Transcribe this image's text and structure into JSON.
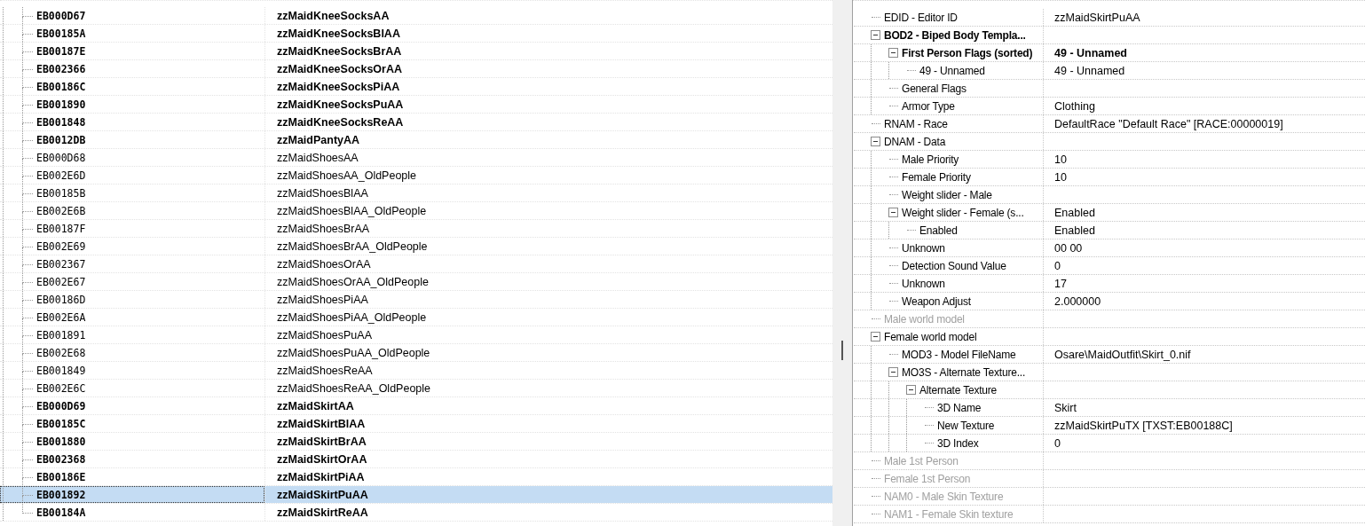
{
  "records": [
    {
      "form_id": "EB000D67",
      "editor_id": "zzMaidKneeSocksAA",
      "bold": true,
      "selected": false
    },
    {
      "form_id": "EB00185A",
      "editor_id": "zzMaidKneeSocksBlAA",
      "bold": true,
      "selected": false
    },
    {
      "form_id": "EB00187E",
      "editor_id": "zzMaidKneeSocksBrAA",
      "bold": true,
      "selected": false
    },
    {
      "form_id": "EB002366",
      "editor_id": "zzMaidKneeSocksOrAA",
      "bold": true,
      "selected": false
    },
    {
      "form_id": "EB00186C",
      "editor_id": "zzMaidKneeSocksPiAA",
      "bold": true,
      "selected": false
    },
    {
      "form_id": "EB001890",
      "editor_id": "zzMaidKneeSocksPuAA",
      "bold": true,
      "selected": false
    },
    {
      "form_id": "EB001848",
      "editor_id": "zzMaidKneeSocksReAA",
      "bold": true,
      "selected": false
    },
    {
      "form_id": "EB0012DB",
      "editor_id": "zzMaidPantyAA",
      "bold": true,
      "selected": false
    },
    {
      "form_id": "EB000D68",
      "editor_id": "zzMaidShoesAA",
      "bold": false,
      "selected": false
    },
    {
      "form_id": "EB002E6D",
      "editor_id": "zzMaidShoesAA_OldPeople",
      "bold": false,
      "selected": false
    },
    {
      "form_id": "EB00185B",
      "editor_id": "zzMaidShoesBlAA",
      "bold": false,
      "selected": false
    },
    {
      "form_id": "EB002E6B",
      "editor_id": "zzMaidShoesBlAA_OldPeople",
      "bold": false,
      "selected": false
    },
    {
      "form_id": "EB00187F",
      "editor_id": "zzMaidShoesBrAA",
      "bold": false,
      "selected": false
    },
    {
      "form_id": "EB002E69",
      "editor_id": "zzMaidShoesBrAA_OldPeople",
      "bold": false,
      "selected": false
    },
    {
      "form_id": "EB002367",
      "editor_id": "zzMaidShoesOrAA",
      "bold": false,
      "selected": false
    },
    {
      "form_id": "EB002E67",
      "editor_id": "zzMaidShoesOrAA_OldPeople",
      "bold": false,
      "selected": false
    },
    {
      "form_id": "EB00186D",
      "editor_id": "zzMaidShoesPiAA",
      "bold": false,
      "selected": false
    },
    {
      "form_id": "EB002E6A",
      "editor_id": "zzMaidShoesPiAA_OldPeople",
      "bold": false,
      "selected": false
    },
    {
      "form_id": "EB001891",
      "editor_id": "zzMaidShoesPuAA",
      "bold": false,
      "selected": false
    },
    {
      "form_id": "EB002E68",
      "editor_id": "zzMaidShoesPuAA_OldPeople",
      "bold": false,
      "selected": false
    },
    {
      "form_id": "EB001849",
      "editor_id": "zzMaidShoesReAA",
      "bold": false,
      "selected": false
    },
    {
      "form_id": "EB002E6C",
      "editor_id": "zzMaidShoesReAA_OldPeople",
      "bold": false,
      "selected": false
    },
    {
      "form_id": "EB000D69",
      "editor_id": "zzMaidSkirtAA",
      "bold": true,
      "selected": false
    },
    {
      "form_id": "EB00185C",
      "editor_id": "zzMaidSkirtBlAA",
      "bold": true,
      "selected": false
    },
    {
      "form_id": "EB001880",
      "editor_id": "zzMaidSkirtBrAA",
      "bold": true,
      "selected": false
    },
    {
      "form_id": "EB002368",
      "editor_id": "zzMaidSkirtOrAA",
      "bold": true,
      "selected": false
    },
    {
      "form_id": "EB00186E",
      "editor_id": "zzMaidSkirtPiAA",
      "bold": true,
      "selected": false
    },
    {
      "form_id": "EB001892",
      "editor_id": "zzMaidSkirtPuAA",
      "bold": true,
      "selected": true
    },
    {
      "form_id": "EB00184A",
      "editor_id": "zzMaidSkirtReAA",
      "bold": true,
      "selected": false
    }
  ],
  "fields": [
    {
      "label": "EDID - Editor ID",
      "value": "zzMaidSkirtPuAA",
      "bold": false,
      "disabled": false
    },
    {
      "label": "BOD2 - Biped Body Templa...",
      "bold": true,
      "disabled": false,
      "expanded": true,
      "children": [
        {
          "label": "First Person Flags (sorted)",
          "value": "49 - Unnamed",
          "bold": true,
          "disabled": false,
          "expanded": true,
          "children": [
            {
              "label": "49 - Unnamed",
              "value": "49 - Unnamed",
              "bold": false,
              "disabled": false
            }
          ]
        },
        {
          "label": "General Flags",
          "bold": false,
          "disabled": false
        },
        {
          "label": "Armor Type",
          "value": "Clothing",
          "bold": false,
          "disabled": false
        }
      ]
    },
    {
      "label": "RNAM - Race",
      "value": "DefaultRace \"Default Race\" [RACE:00000019]",
      "bold": false,
      "disabled": false
    },
    {
      "label": "DNAM - Data",
      "bold": false,
      "disabled": false,
      "expanded": true,
      "children": [
        {
          "label": "Male Priority",
          "value": "10",
          "bold": false,
          "disabled": false
        },
        {
          "label": "Female Priority",
          "value": "10",
          "bold": false,
          "disabled": false
        },
        {
          "label": "Weight slider - Male",
          "bold": false,
          "disabled": false
        },
        {
          "label": "Weight slider - Female (s...",
          "value": "Enabled",
          "bold": false,
          "disabled": false,
          "expanded": true,
          "children": [
            {
              "label": "Enabled",
              "value": "Enabled",
              "bold": false,
              "disabled": false
            }
          ]
        },
        {
          "label": "Unknown",
          "value": "00 00",
          "bold": false,
          "disabled": false
        },
        {
          "label": "Detection Sound Value",
          "value": "0",
          "bold": false,
          "disabled": false
        },
        {
          "label": "Unknown",
          "value": "17",
          "bold": false,
          "disabled": false
        },
        {
          "label": "Weapon Adjust",
          "value": "2.000000",
          "bold": false,
          "disabled": false
        }
      ]
    },
    {
      "label": "Male world model",
      "bold": false,
      "disabled": true
    },
    {
      "label": "Female world model",
      "bold": false,
      "disabled": false,
      "expanded": true,
      "children": [
        {
          "label": "MOD3 - Model FileName",
          "value": "Osare\\MaidOutfit\\Skirt_0.nif",
          "bold": false,
          "disabled": false
        },
        {
          "label": "MO3S - Alternate Texture...",
          "bold": false,
          "disabled": false,
          "expanded": true,
          "children": [
            {
              "label": "Alternate Texture",
              "bold": false,
              "disabled": false,
              "expanded": true,
              "children": [
                {
                  "label": "3D Name",
                  "value": "Skirt",
                  "bold": false,
                  "disabled": false
                },
                {
                  "label": "New Texture",
                  "value": "zzMaidSkirtPuTX [TXST:EB00188C]",
                  "bold": false,
                  "disabled": false
                },
                {
                  "label": "3D Index",
                  "value": "0",
                  "bold": false,
                  "disabled": false
                }
              ]
            }
          ]
        }
      ]
    },
    {
      "label": "Male 1st Person",
      "bold": false,
      "disabled": true
    },
    {
      "label": "Female 1st Person",
      "bold": false,
      "disabled": true
    },
    {
      "label": "NAM0 - Male Skin Texture",
      "bold": false,
      "disabled": true
    },
    {
      "label": "NAM1 - Female Skin texture",
      "bold": false,
      "disabled": true
    }
  ]
}
